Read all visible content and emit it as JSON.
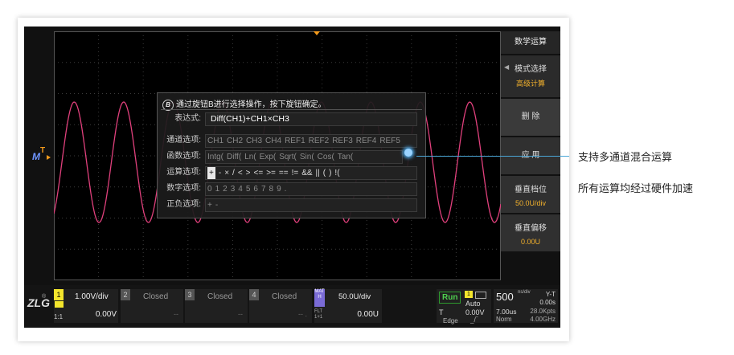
{
  "dialog": {
    "hint": "通过旋钮B进行选择操作，按下旋钮确定。",
    "hint_icon_letter": "B",
    "expr_label": "表达式:",
    "expression": "Diff(CH1)+CH1×CH3",
    "channel_label": "通道选项:",
    "channels": [
      "CH1",
      "CH2",
      "CH3",
      "CH4",
      "REF1",
      "REF2",
      "REF3",
      "REF4",
      "REF5"
    ],
    "func_label": "函数选项:",
    "functions": [
      "Intg(",
      "Diff(",
      "Ln(",
      "Exp(",
      "Sqrt(",
      "Sin(",
      "Cos(",
      "Tan("
    ],
    "op_label": "运算选项:",
    "operators": [
      "+",
      "-",
      "×",
      "/",
      "<",
      ">",
      "<=",
      ">=",
      "==",
      "!=",
      "&&",
      "||",
      "(",
      ")",
      "!("
    ],
    "num_label": "数字选项:",
    "numbers": [
      "0",
      "1",
      "2",
      "3",
      "4",
      "5",
      "6",
      "7",
      "8",
      "9",
      "."
    ],
    "sign_label": "正负选项:",
    "signs": [
      "+",
      "-"
    ]
  },
  "side_menu": {
    "title": "数学运算",
    "mode_label": "模式选择",
    "mode_value": "高级计算",
    "delete": "删 除",
    "apply": "应 用",
    "vscale_label": "垂直档位",
    "vscale_value": "50.0U/div",
    "voffset_label": "垂直偏移",
    "voffset_value": "0.00U"
  },
  "markers": {
    "math": "M",
    "trigger": "T"
  },
  "status": {
    "ch1_scale": "1.00V/div",
    "ch1_offset": "0.00V",
    "ch1_num": "1",
    "ch1_coupling": "1:1",
    "ch2_num": "2",
    "ch2_state": "Closed",
    "ch3_num": "3",
    "ch3_state": "Closed",
    "ch4_num": "4",
    "ch4_state": "Closed",
    "closed_dash": "--",
    "closed_dash2": "-- .",
    "math_label": "MATH",
    "math_sub": "FLT 1+1",
    "math_scale": "50.0U/div",
    "math_offset": "0.00U",
    "run": "Run",
    "trig_ch": "1",
    "trig_mode": "Auto",
    "trig_level": "0.00V",
    "trig_type": "Edge",
    "trig_source": "T",
    "timebase": "500",
    "timebase_unit": "ns/div",
    "time_offset": "7.00us",
    "acq": "Norm",
    "sample_rate": "28.0Kpts",
    "sample_freq": "4.00GHz",
    "mode_yt": "Y-T",
    "mode_yt_time": "0.00s",
    "logo": "ZLG"
  },
  "annotations": {
    "line1": "支持多通道混合运算",
    "line2": "所有运算均经过硬件加速"
  },
  "colors": {
    "wave": "#e0407c",
    "grid": "#3a3a3a",
    "accent": "#4aa6d6",
    "ch1": "#f3e52c",
    "math": "#7a6bd6"
  }
}
